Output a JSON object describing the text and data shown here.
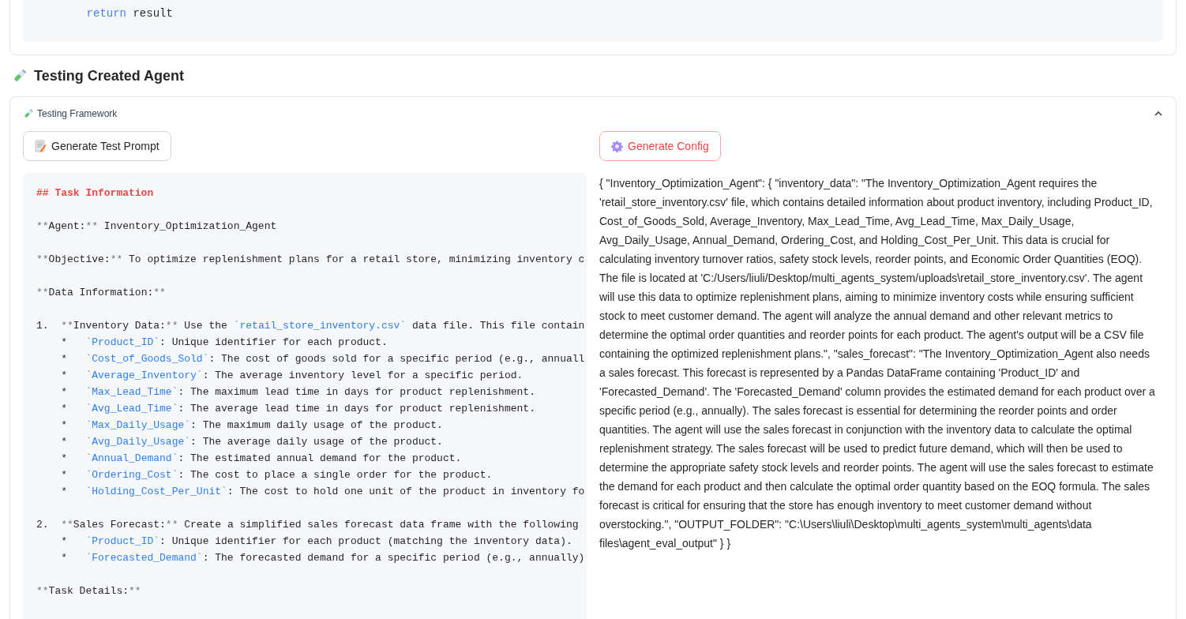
{
  "code_card": {
    "lines": [
      "    return result"
    ]
  },
  "section_title": "Testing Created Agent",
  "accordion": {
    "title": "Testing Framework",
    "expanded": true
  },
  "left": {
    "button": "Generate Test Prompt",
    "blocks": [
      {
        "lines": [
          {
            "kind": "heading",
            "text": "## Task Information"
          }
        ]
      },
      {
        "lines": [
          {
            "kind": "text",
            "parts": [
              "**",
              "Agent:",
              "**",
              " Inventory_Optimization_Agent"
            ]
          }
        ]
      },
      {
        "lines": [
          {
            "kind": "text",
            "parts": [
              "**",
              "Objective:",
              "**",
              " To optimize replenishment plans for a retail store, minimizing inventory c"
            ]
          }
        ]
      },
      {
        "lines": [
          {
            "kind": "text",
            "parts": [
              "**",
              "Data Information:",
              "**"
            ]
          }
        ]
      },
      {
        "lines": [
          {
            "kind": "text",
            "text": "1.  **Inventory Data:** Use the `retail_store_inventory.csv` data file. This file contain"
          },
          {
            "kind": "text",
            "text": "    *   `Product_ID`: Unique identifier for each product."
          },
          {
            "kind": "text",
            "text": "    *   `Cost_of_Goods_Sold`: The cost of goods sold for a specific period (e.g., annuall"
          },
          {
            "kind": "text",
            "text": "    *   `Average_Inventory`: The average inventory level for a specific period."
          },
          {
            "kind": "text",
            "text": "    *   `Max_Lead_Time`: The maximum lead time in days for product replenishment."
          },
          {
            "kind": "text",
            "text": "    *   `Avg_Lead_Time`: The average lead time in days for product replenishment."
          },
          {
            "kind": "text",
            "text": "    *   `Max_Daily_Usage`: The maximum daily usage of the product."
          },
          {
            "kind": "text",
            "text": "    *   `Avg_Daily_Usage`: The average daily usage of the product."
          },
          {
            "kind": "text",
            "text": "    *   `Annual_Demand`: The estimated annual demand for the product."
          },
          {
            "kind": "text",
            "text": "    *   `Ordering_Cost`: The cost to place a single order for the product."
          },
          {
            "kind": "text",
            "text": "    *   `Holding_Cost_Per_Unit`: The cost to hold one unit of the product in inventory fo"
          }
        ]
      },
      {
        "lines": [
          {
            "kind": "text",
            "text": "2.  **Sales Forecast:** Create a simplified sales forecast data frame with the following"
          },
          {
            "kind": "text",
            "text": "    *   `Product_ID`: Unique identifier for each product (matching the inventory data)."
          },
          {
            "kind": "text",
            "text": "    *   `Forecasted_Demand`: The forecasted demand for a specific period (e.g., annually)"
          }
        ]
      },
      {
        "lines": [
          {
            "kind": "text",
            "parts": [
              "**",
              "Task Details:",
              "**"
            ]
          }
        ]
      }
    ]
  },
  "right": {
    "button": "Generate Config",
    "config_text": "{ \"Inventory_Optimization_Agent\": { \"inventory_data\": \"The Inventory_Optimization_Agent requires the 'retail_store_inventory.csv' file, which contains detailed information about product inventory, including Product_ID, Cost_of_Goods_Sold, Average_Inventory, Max_Lead_Time, Avg_Lead_Time, Max_Daily_Usage, Avg_Daily_Usage, Annual_Demand, Ordering_Cost, and Holding_Cost_Per_Unit. This data is crucial for calculating inventory turnover ratios, safety stock levels, reorder points, and Economic Order Quantities (EOQ). The file is located at 'C:/Users/liuli/Desktop/multi_agents_system/uploads\\retail_store_inventory.csv'. The agent will use this data to optimize replenishment plans, aiming to minimize inventory costs while ensuring sufficient stock to meet customer demand. The agent will analyze the annual demand and other relevant metrics to determine the optimal order quantities and reorder points for each product. The agent's output will be a CSV file containing the optimized replenishment plans.\", \"sales_forecast\": \"The Inventory_Optimization_Agent also needs a sales forecast. This forecast is represented by a Pandas DataFrame containing 'Product_ID' and 'Forecasted_Demand'. The 'Forecasted_Demand' column provides the estimated demand for each product over a specific period (e.g., annually). The sales forecast is essential for determining the reorder points and order quantities. The agent will use the sales forecast in conjunction with the inventory data to calculate the optimal replenishment strategy. The sales forecast will be used to predict future demand, which will then be used to determine the appropriate safety stock levels and reorder points. The agent will use the sales forecast to estimate the demand for each product and then calculate the optimal order quantity based on the EOQ formula. The sales forecast is critical for ensuring that the store has enough inventory to meet customer demand without overstocking.\", \"OUTPUT_FOLDER\": \"C:\\Users\\liuli\\Desktop\\multi_agents_system\\multi_agents\\data files\\agent_eval_output\" } }"
  }
}
